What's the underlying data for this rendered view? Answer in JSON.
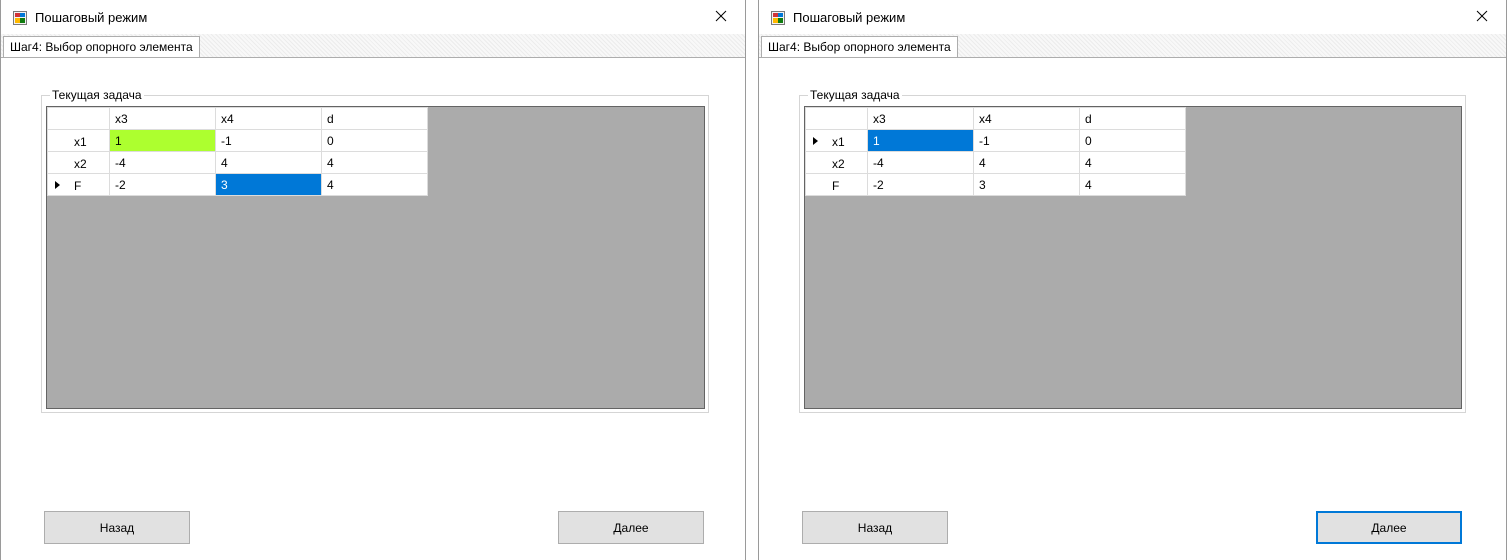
{
  "windows": [
    {
      "title": "Пошаговый режим",
      "tab_label": "Шаг4: Выбор опорного элемента",
      "group_label": "Текущая задача",
      "grid": {
        "columns": [
          "x3",
          "x4",
          "d"
        ],
        "rows": [
          {
            "label": "x1",
            "cells": [
              "1",
              "-1",
              "0"
            ],
            "current": false
          },
          {
            "label": "x2",
            "cells": [
              "-4",
              "4",
              "4"
            ],
            "current": false
          },
          {
            "label": "F",
            "cells": [
              "-2",
              "3",
              "4"
            ],
            "current": true
          }
        ],
        "highlight_green": {
          "row": 0,
          "col": 0
        },
        "selected_cell": {
          "row": 2,
          "col": 1
        }
      },
      "back_button": "Назад",
      "next_button": "Далее",
      "next_focused": false
    },
    {
      "title": "Пошаговый режим",
      "tab_label": "Шаг4: Выбор опорного элемента",
      "group_label": "Текущая задача",
      "grid": {
        "columns": [
          "x3",
          "x4",
          "d"
        ],
        "rows": [
          {
            "label": "x1",
            "cells": [
              "1",
              "-1",
              "0"
            ],
            "current": true
          },
          {
            "label": "x2",
            "cells": [
              "-4",
              "4",
              "4"
            ],
            "current": false
          },
          {
            "label": "F",
            "cells": [
              "-2",
              "3",
              "4"
            ],
            "current": false
          }
        ],
        "highlight_green": null,
        "selected_cell": {
          "row": 0,
          "col": 0
        }
      },
      "back_button": "Назад",
      "next_button": "Далее",
      "next_focused": true
    }
  ],
  "colors": {
    "pivot_green": "#adff2f",
    "selection_blue": "#0078d7",
    "grid_background": "#ababab"
  },
  "icons": {
    "app": "app-form-icon",
    "close": "close-icon",
    "row_pointer": "row-pointer-icon"
  }
}
